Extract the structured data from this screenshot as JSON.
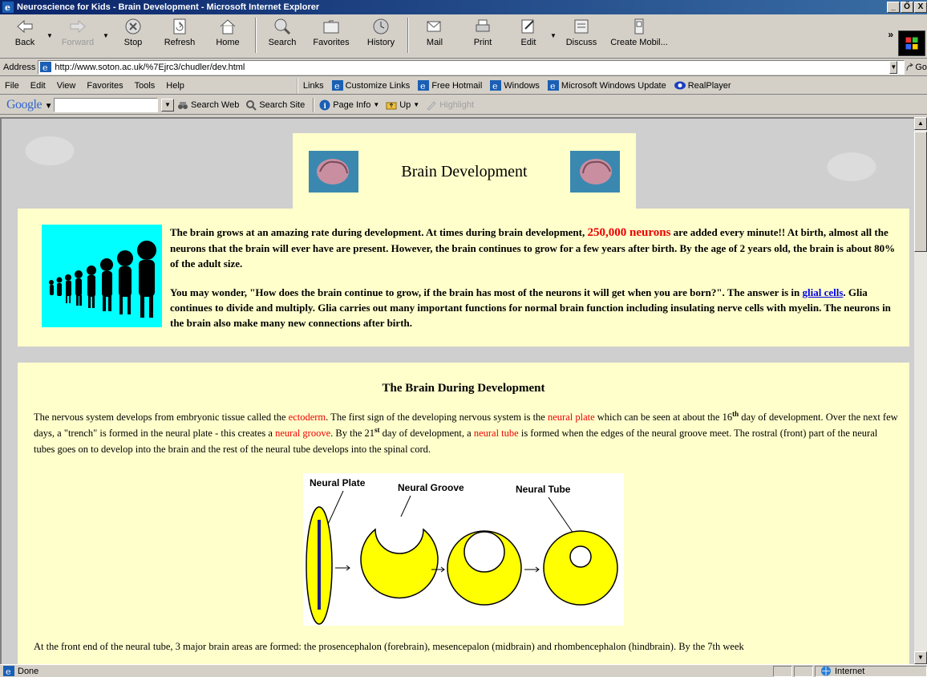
{
  "window": {
    "title": "Neuroscience for Kids - Brain Development - Microsoft Internet Explorer",
    "min_label": "_",
    "max_label": "×",
    "close_label": "X",
    "restore_label": "Ő"
  },
  "toolbar": {
    "back": "Back",
    "forward": "Forward",
    "stop": "Stop",
    "refresh": "Refresh",
    "home": "Home",
    "search": "Search",
    "favorites": "Favorites",
    "history": "History",
    "mail": "Mail",
    "print": "Print",
    "edit": "Edit",
    "discuss": "Discuss",
    "create_mobile": "Create Mobil...",
    "chevron": "»"
  },
  "address": {
    "label": "Address",
    "url": "http://www.soton.ac.uk/%7Ejrc3/chudler/dev.html",
    "go": "Go"
  },
  "menu": {
    "file": "File",
    "edit": "Edit",
    "view": "View",
    "favorites": "Favorites",
    "tools": "Tools",
    "help": "Help"
  },
  "links": {
    "label": "Links",
    "items": [
      "Customize Links",
      "Free Hotmail",
      "Windows",
      "Microsoft Windows Update",
      "RealPlayer"
    ]
  },
  "google": {
    "logo": "Google",
    "search_web": "Search Web",
    "search_site": "Search Site",
    "page_info": "Page Info",
    "up": "Up",
    "highlight": "Highlight"
  },
  "page": {
    "title": "Brain Development",
    "intro_p1_a": "The brain grows at an amazing rate during development. At times during brain development, ",
    "intro_p1_red": "250,000 neurons",
    "intro_p1_b": " are added every minute!! At birth, almost all the neurons that the brain will ever have are present. However, the brain continues to grow for a few years after birth. By the age of 2 years old, the brain is about 80% of the adult size.",
    "intro_p2_a": "You may wonder, \"How does the brain continue to grow, if the brain has most of the neurons it will get when you are born?\". The answer is in ",
    "intro_p2_link": "glial cells",
    "intro_p2_b": ". Glia continues to divide and multiply. Glia carries out many important functions for normal brain function including insulating nerve cells with myelin. The neurons in the brain also make many new connections after birth.",
    "dev_heading": "The Brain During Development",
    "dev_t1": "The nervous system develops from embryonic tissue called the ",
    "dev_red1": "ectoderm",
    "dev_t2": ". The first sign of the developing nervous system is the ",
    "dev_red2": "neural plate",
    "dev_t3": " which can be seen at about the 16",
    "dev_sup1": "th",
    "dev_t4": " day of development. Over the next few days, a \"trench\" is formed in the neural plate - this creates a ",
    "dev_red3": "neural groove",
    "dev_t5": ". By the 21",
    "dev_sup2": "st",
    "dev_t6": " day of development, a ",
    "dev_red4": "neural tube",
    "dev_t7": " is formed when the edges of the neural groove meet. The rostral (front) part of the neural tubes goes on to develop into the brain and the rest of the neural tube develops into the spinal cord.",
    "diagram_labels": [
      "Neural Plate",
      "Neural Groove",
      "Neural Tube"
    ],
    "dev_next": "At the front end of the neural tube, 3 major brain areas are formed: the prosencephalon (forebrain), mesencepalon (midbrain) and rhombencephalon (hindbrain). By the 7th week"
  },
  "status": {
    "text": "Done",
    "zone": "Internet"
  },
  "colors": {
    "page_bg": "#ffffcc",
    "accent_red": "#e00000",
    "link": "#0000ee",
    "title_bar": "#0a246a"
  }
}
